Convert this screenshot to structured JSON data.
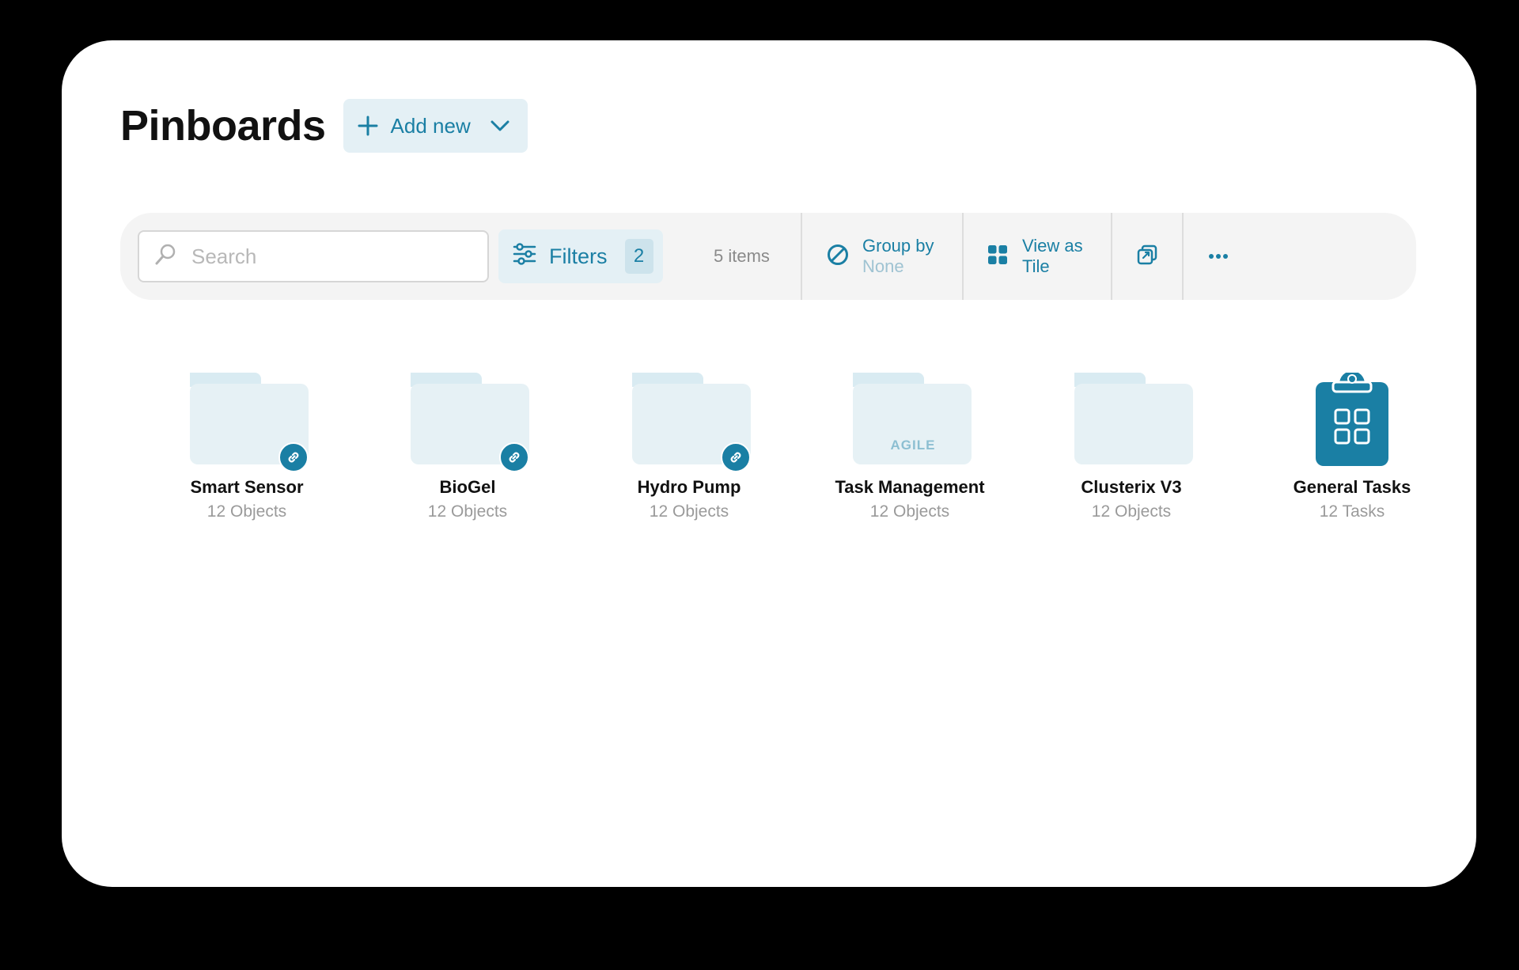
{
  "header": {
    "title": "Pinboards",
    "add_new_label": "Add new"
  },
  "toolbar": {
    "search_placeholder": "Search",
    "filters_label": "Filters",
    "filters_count": "2",
    "items_count": "5 items",
    "group_by_label": "Group by",
    "group_by_value": "None",
    "view_as_label": "View as",
    "view_as_value": "Tile"
  },
  "tiles": [
    {
      "name": "Smart Sensor",
      "count": "12 Objects",
      "icon": "folder-icon",
      "linked": true
    },
    {
      "name": "BioGel",
      "count": "12 Objects",
      "icon": "folder-icon",
      "linked": true
    },
    {
      "name": "Hydro Pump",
      "count": "12 Objects",
      "icon": "folder-icon",
      "linked": true
    },
    {
      "name": "Task Management",
      "count": "12 Objects",
      "icon": "folder-icon",
      "folder_label": "AGILE",
      "linked": false
    },
    {
      "name": "Clusterix V3",
      "count": "12 Objects",
      "icon": "folder-icon",
      "linked": false
    },
    {
      "name": "General Tasks",
      "count": "12 Tasks",
      "icon": "clipboard-grid-icon",
      "linked": false
    }
  ],
  "colors": {
    "accent": "#1a7fa4",
    "accent_bg": "#e4f0f5",
    "folder": "#e3eff4"
  }
}
